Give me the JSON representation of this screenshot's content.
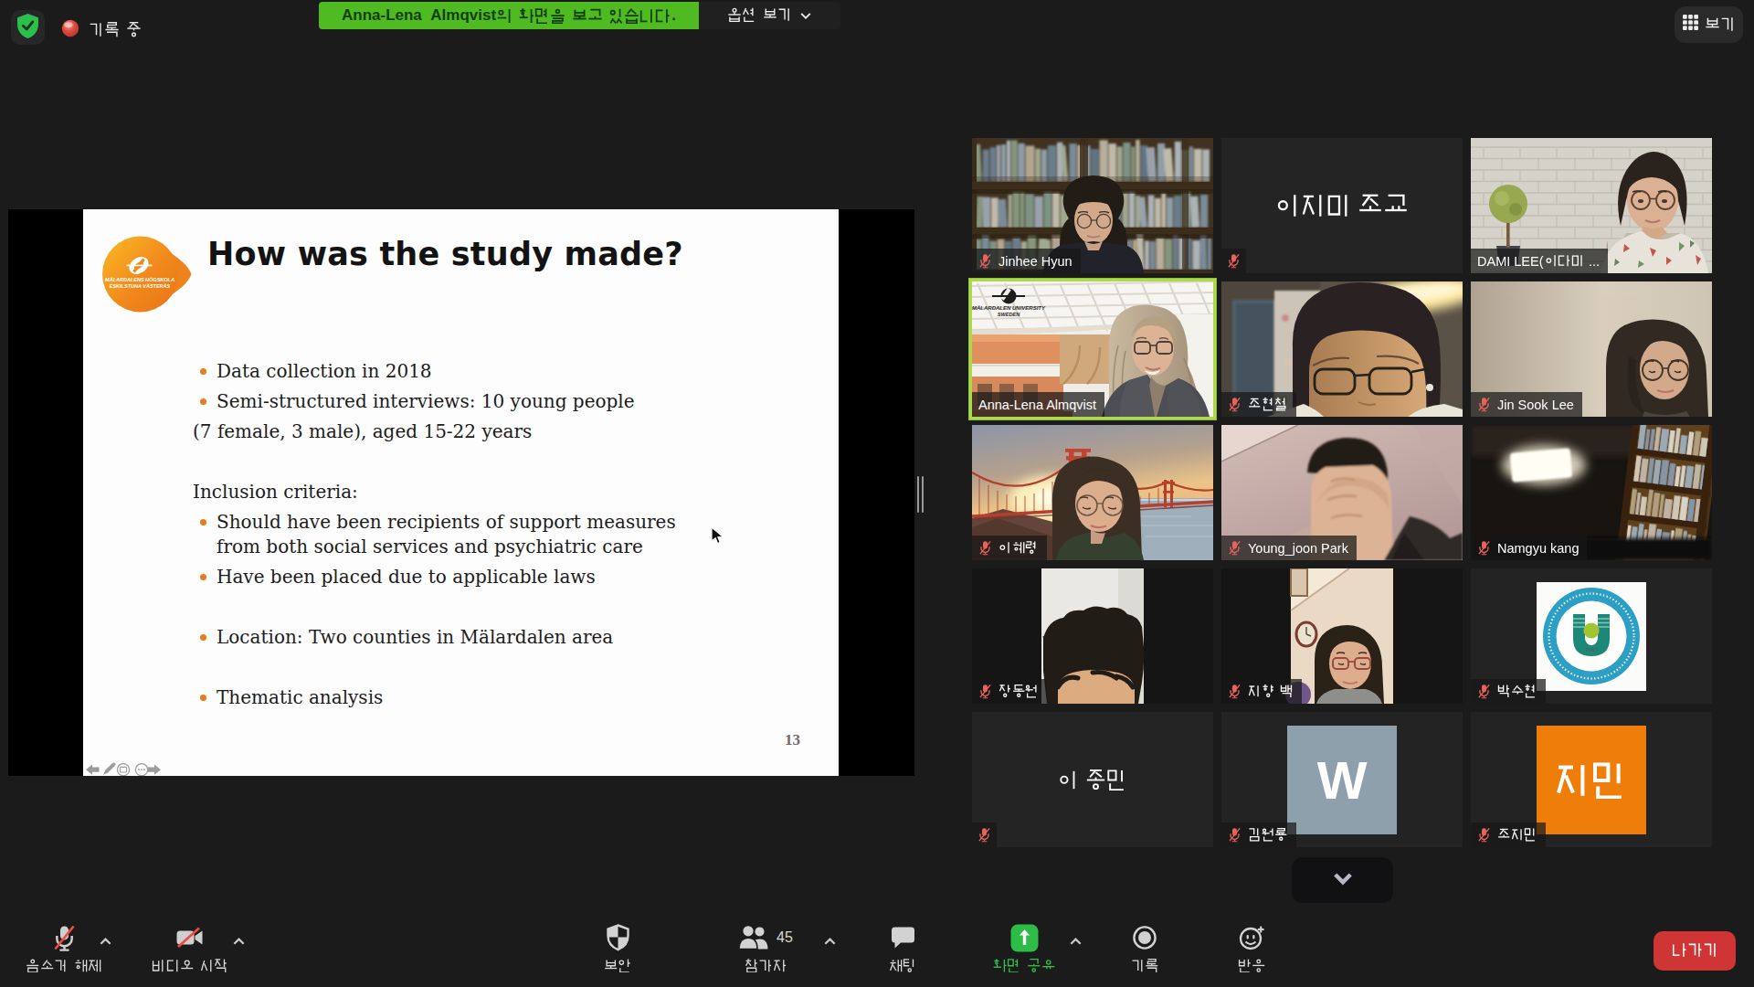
{
  "top_bar": {
    "recording_label": "기록 중",
    "banner_text": "Anna-Lena  Almqvist의 화면을 보고 있습니다.",
    "banner_options_label": "옵션 보기",
    "view_label": "보기"
  },
  "slide": {
    "logo_line1": "MÄLARDALENS HÖGSKOLA",
    "logo_line2": "ESKILSTUNA VÄSTERÅS",
    "title": "How was the study made?",
    "lines": [
      {
        "bullet": true,
        "text": "Data collection in 2018",
        "gap": 0
      },
      {
        "bullet": true,
        "text": "Semi-structured interviews: 10 young people",
        "gap": 6
      },
      {
        "bullet": false,
        "text": "(7 female, 3 male), aged 15-22 years",
        "gap": 6
      },
      {
        "bullet": false,
        "text": "Inclusion criteria:",
        "gap": 39
      },
      {
        "bullet": true,
        "text": "Should have been recipients of support measures",
        "gap": 6
      },
      {
        "bullet": false,
        "text": "from both social services and psychiatric care",
        "gap": 0,
        "indent": true
      },
      {
        "bullet": true,
        "text": "Have been placed due to applicable laws",
        "gap": 6
      },
      {
        "bullet": true,
        "text": "Location: Two counties in Mälardalen area",
        "gap": 39
      },
      {
        "bullet": true,
        "text": "Thematic analysis",
        "gap": 39
      }
    ],
    "page_number": "13"
  },
  "participants": [
    {
      "name": "Jinhee Hyun",
      "muted": true,
      "scene": "bookshelf"
    },
    {
      "name": "이지미 조교",
      "muted": true,
      "scene": "none",
      "center_name": true,
      "center_size": 28
    },
    {
      "name": "DAMI LEE(이다미 ...",
      "muted": false,
      "scene": "brick"
    },
    {
      "name": "Anna-Lena Almqvist",
      "muted": false,
      "scene": "atrium",
      "active": true
    },
    {
      "name": "조현철",
      "muted": true,
      "scene": "dimroom"
    },
    {
      "name": "Jin Sook Lee",
      "muted": true,
      "scene": "beige"
    },
    {
      "name": "이혜령",
      "muted": true,
      "scene": "bridge"
    },
    {
      "name": "Young_joon Park",
      "muted": true,
      "scene": "pinkwall"
    },
    {
      "name": "Namgyu kang",
      "muted": true,
      "scene": "darklight"
    },
    {
      "name": "장동원",
      "muted": true,
      "scene": "portraithead"
    },
    {
      "name": "지향 백",
      "muted": true,
      "scene": "portraitwoman"
    },
    {
      "name": "박수현",
      "muted": true,
      "scene": "emblem"
    },
    {
      "name": "이 종민",
      "muted": true,
      "scene": "none",
      "center_name": true,
      "center_size": 23
    },
    {
      "name": "김원룡",
      "muted": true,
      "scene": "avatarW",
      "avatar_text": "W"
    },
    {
      "name": "조지민",
      "muted": true,
      "scene": "avatarJM",
      "avatar_text": "지민"
    }
  ],
  "toolbar": {
    "mute_label": "음소거 해제",
    "video_label": "비디오 시작",
    "security_label": "보안",
    "participants_label": "참가자",
    "participants_count": "45",
    "chat_label": "채팅",
    "share_label": "화면 공유",
    "record_label": "기록",
    "reactions_label": "반응",
    "leave_label": "나가기"
  },
  "colors": {
    "banner_green": "#50ba22",
    "share_green": "#2dbd46",
    "leave_red": "#cf3535",
    "active_border": "#aed84e",
    "avatar_w_bg": "#8ea0ac",
    "avatar_jm_bg": "#ee7d09"
  }
}
